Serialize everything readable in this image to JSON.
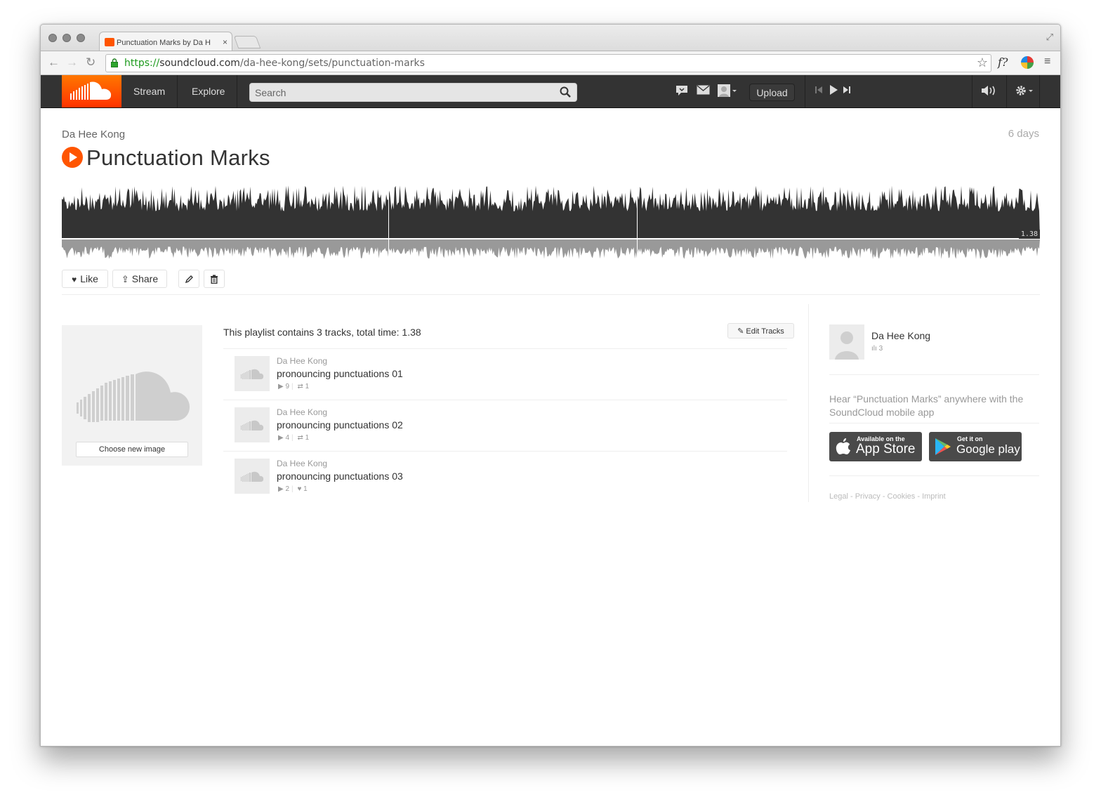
{
  "browser": {
    "tab_title": "Punctuation Marks by Da H",
    "tab_close": "×",
    "url_scheme": "https://",
    "url_host": "soundcloud.com",
    "url_path": "/da-hee-kong/sets/punctuation-marks",
    "ext_label": "f?"
  },
  "header": {
    "nav_stream": "Stream",
    "nav_explore": "Explore",
    "search_placeholder": "Search",
    "upload_label": "Upload"
  },
  "set": {
    "artist": "Da Hee Kong",
    "age": "6 days",
    "title": "Punctuation Marks",
    "duration": "1.38",
    "actions": {
      "like": "Like",
      "share": "Share"
    }
  },
  "artwork": {
    "choose_label": "Choose new image"
  },
  "tracklist": {
    "summary": "This playlist contains 3 tracks, total time: 1.38",
    "edit_label": "Edit Tracks",
    "tracks": [
      {
        "artist": "Da Hee Kong",
        "title": "pronouncing punctuations 01",
        "plays": "9",
        "second_stat": "1",
        "second_icon": "repost-icon"
      },
      {
        "artist": "Da Hee Kong",
        "title": "pronouncing punctuations 02",
        "plays": "4",
        "second_stat": "1",
        "second_icon": "repost-icon"
      },
      {
        "artist": "Da Hee Kong",
        "title": "pronouncing punctuations 03",
        "plays": "2",
        "second_stat": "1",
        "second_icon": "heart-icon"
      }
    ]
  },
  "sidebar": {
    "user_name": "Da Hee Kong",
    "user_tracks": "3",
    "promo_text": "Hear “Punctuation Marks” anywhere with the SoundCloud mobile app",
    "appstore_small": "Available on the",
    "appstore_big": "App Store",
    "googleplay_small": "Get it on",
    "googleplay_big": "Google play",
    "footer": {
      "legal": "Legal",
      "privacy": "Privacy",
      "cookies": "Cookies",
      "imprint": "Imprint",
      "separator": " - "
    }
  },
  "colors": {
    "brand": "#ff5500",
    "header_bg": "#333333",
    "waveform_top": "#333333",
    "waveform_bottom": "#999999"
  }
}
